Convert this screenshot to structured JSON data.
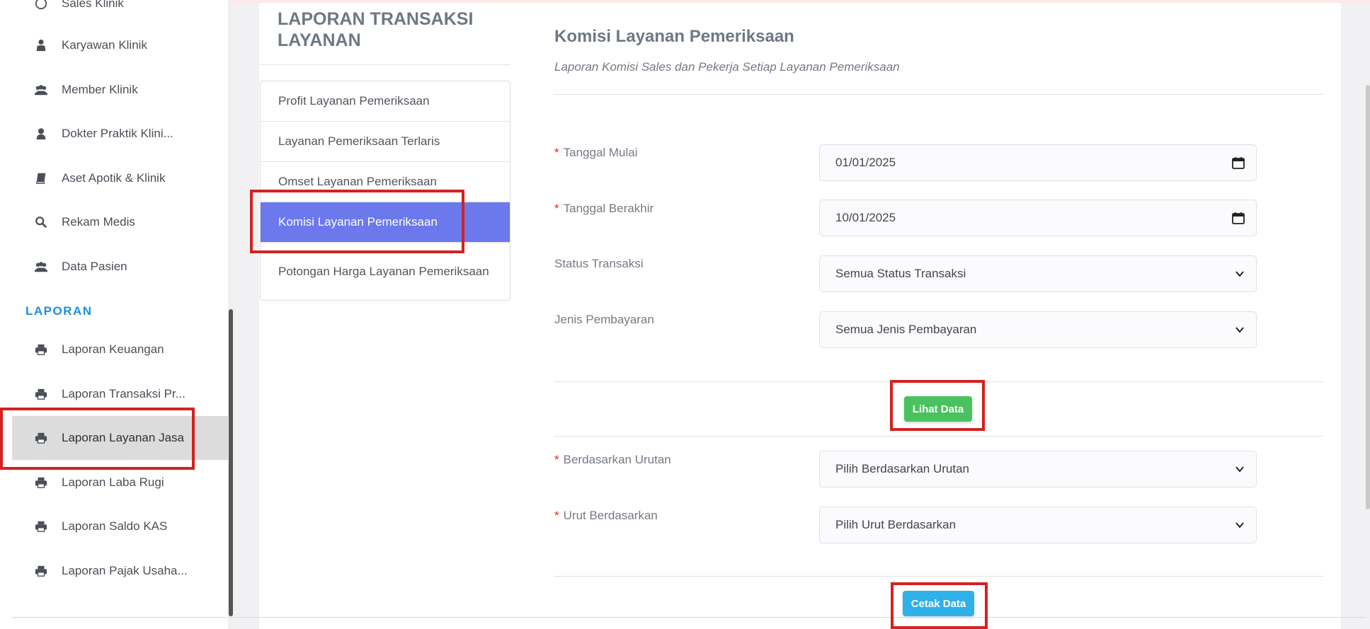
{
  "sidebar": {
    "items": [
      {
        "label": "Sales Klinik",
        "icon": "user-circle-icon"
      },
      {
        "label": "Karyawan Klinik",
        "icon": "user-tie-icon"
      },
      {
        "label": "Member Klinik",
        "icon": "users-icon"
      },
      {
        "label": "Dokter Praktik Klini...",
        "icon": "user-icon"
      },
      {
        "label": "Aset Apotik & Klinik",
        "icon": "book-icon"
      },
      {
        "label": "Rekam Medis",
        "icon": "search-icon"
      },
      {
        "label": "Data Pasien",
        "icon": "users-icon"
      }
    ],
    "section_heading": "LAPORAN",
    "report_items": [
      {
        "label": "Laporan Keuangan",
        "icon": "printer-icon"
      },
      {
        "label": "Laporan Transaksi Pr...",
        "icon": "printer-icon"
      },
      {
        "label": "Laporan Layanan Jasa",
        "icon": "printer-icon",
        "active": true
      },
      {
        "label": "Laporan Laba Rugi",
        "icon": "printer-icon"
      },
      {
        "label": "Laporan Saldo KAS",
        "icon": "printer-icon"
      },
      {
        "label": "Laporan Pajak Usaha...",
        "icon": "printer-icon"
      }
    ]
  },
  "report_menu": {
    "title": "LAPORAN TRANSAKSI LAYANAN",
    "items": [
      {
        "label": "Profit Layanan Pemeriksaan"
      },
      {
        "label": "Layanan Pemeriksaan Terlaris"
      },
      {
        "label": "Omset Layanan Pemeriksaan"
      },
      {
        "label": "Komisi Layanan Pemeriksaan",
        "active": true
      },
      {
        "label": "Potongan Harga Layanan Pemeriksaan"
      }
    ]
  },
  "form": {
    "heading": "Komisi Layanan Pemeriksaan",
    "subheading": "Laporan Komisi Sales dan Pekerja Setiap Layanan Pemeriksaan",
    "required_mark": "*",
    "fields": {
      "start_date": {
        "label": "Tanggal Mulai",
        "value": "01/01/2025"
      },
      "end_date": {
        "label": "Tanggal Berakhir",
        "value": "10/01/2025"
      },
      "status": {
        "label": "Status Transaksi",
        "value": "Semua Status Transaksi"
      },
      "payment": {
        "label": "Jenis Pembayaran",
        "value": "Semua Jenis Pembayaran"
      },
      "sort_by": {
        "label": "Berdasarkan Urutan",
        "value": "Pilih Berdasarkan Urutan"
      },
      "order_by": {
        "label": "Urut Berdasarkan",
        "value": "Pilih Urut Berdasarkan"
      }
    },
    "view_button": "Lihat Data",
    "print_button": "Cetak Data"
  },
  "colors": {
    "accent": "#6b79ec",
    "highlight": "#d42121",
    "section_heading": "#1b8fe0",
    "view_button": "#49c25f",
    "print_button": "#2fb0e8"
  }
}
